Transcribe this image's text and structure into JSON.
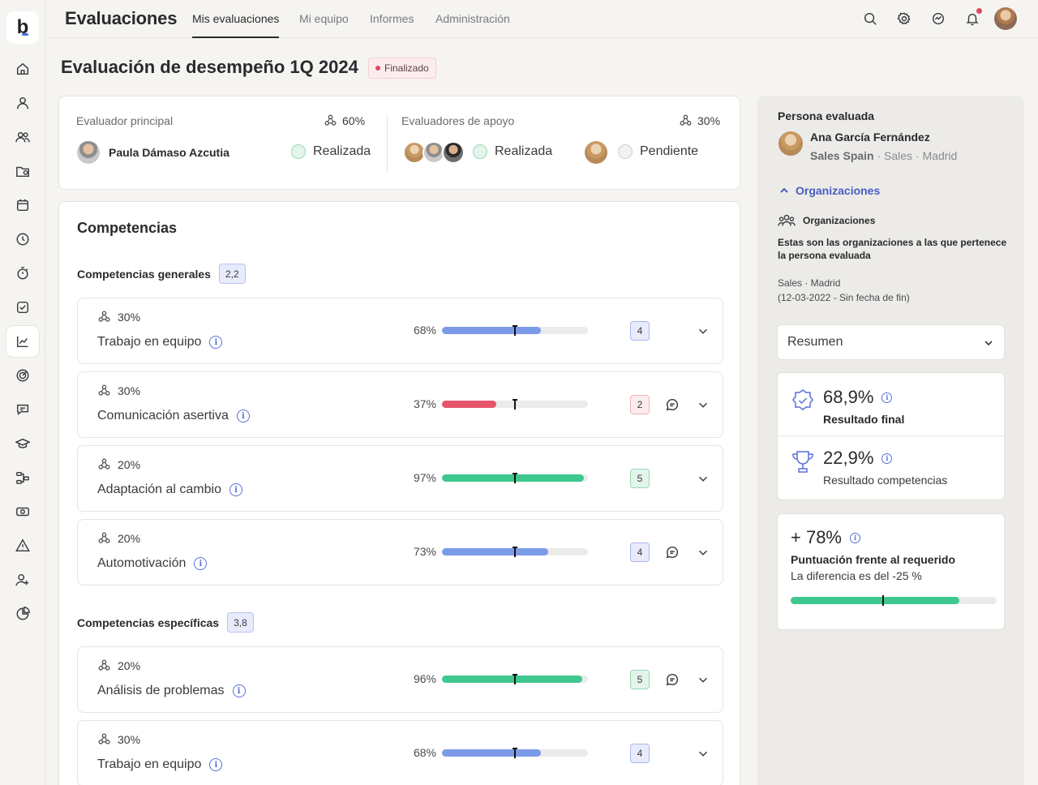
{
  "app": {
    "title": "Evaluaciones",
    "logo_letter": "b"
  },
  "tabs": [
    {
      "label": "Mis evaluaciones",
      "active": true
    },
    {
      "label": "Mi equipo",
      "active": false
    },
    {
      "label": "Informes",
      "active": false
    },
    {
      "label": "Administración",
      "active": false
    }
  ],
  "topbar_icons": [
    "search-icon",
    "settings-icon",
    "activity-icon",
    "bell-icon",
    "user-avatar"
  ],
  "sidebar_icons": [
    "home-icon",
    "user-icon",
    "team-icon",
    "folder-icon",
    "calendar-icon",
    "clock-icon",
    "timer-icon",
    "check-icon",
    "chart-icon",
    "target-icon",
    "chat-icon",
    "graduation-icon",
    "workflow-icon",
    "money-icon",
    "alert-icon",
    "user-add-icon",
    "pie-chart-icon"
  ],
  "page": {
    "title": "Evaluación de desempeño 1Q 2024",
    "status": "Finalizado"
  },
  "evaluators": {
    "main": {
      "label": "Evaluador principal",
      "weight": "60%",
      "name": "Paula Dámaso Azcutia",
      "state": "Realizada"
    },
    "support": {
      "label": "Evaluadores de apoyo",
      "weight": "30%",
      "state_done": "Realizada",
      "state_pending": "Pendiente"
    }
  },
  "competencias": {
    "title": "Competencias",
    "groups": [
      {
        "title": "Competencias generales",
        "score": "2,2",
        "items": [
          {
            "weight": "30%",
            "name": "Trabajo en equipo",
            "percent": "68%",
            "level": 0.68,
            "score": "4",
            "color": "blue",
            "comment": false
          },
          {
            "weight": "30%",
            "name": "Comunicación asertiva",
            "percent": "37%",
            "level": 0.37,
            "score": "2",
            "color": "red",
            "comment": true
          },
          {
            "weight": "20%",
            "name": "Adaptación al cambio",
            "percent": "97%",
            "level": 0.97,
            "score": "5",
            "color": "green",
            "comment": false
          },
          {
            "weight": "20%",
            "name": "Automotivación",
            "percent": "73%",
            "level": 0.73,
            "score": "4",
            "color": "blue",
            "comment": true
          }
        ]
      },
      {
        "title": "Competencias específicas",
        "score": "3,8",
        "items": [
          {
            "weight": "20%",
            "name": "Análisis de problemas",
            "percent": "96%",
            "level": 0.96,
            "score": "5",
            "color": "green",
            "comment": true
          },
          {
            "weight": "30%",
            "name": "Trabajo en equipo",
            "percent": "68%",
            "level": 0.68,
            "score": "4",
            "color": "blue",
            "comment": false
          }
        ]
      }
    ]
  },
  "colors": {
    "blue": "#7b9ae8",
    "red": "#e5566a",
    "green": "#3ec78e",
    "accent": "#4a5bc4"
  },
  "evaluated": {
    "label": "Persona evaluada",
    "name": "Ana García Fernández",
    "company": "Sales Spain",
    "dept": " · Sales · Madrid",
    "org_toggle": "Organizaciones",
    "org_head": "Organizaciones",
    "org_desc": "Estas son las organizaciones a las que pertenece la persona evaluada",
    "org_line1": "Sales · Madrid",
    "org_line2": "(12-03-2022 - Sin fecha de fin)"
  },
  "summary": {
    "select": "Resumen",
    "final_value": "68,9%",
    "final_label": "Resultado final",
    "comp_value": "22,9%",
    "comp_label": "Resultado competencias",
    "req_value": "+ 78%",
    "req_label": "Puntuación frente al requerido",
    "req_diff": "La diferencia es del -25 %",
    "req_level": 0.82
  }
}
